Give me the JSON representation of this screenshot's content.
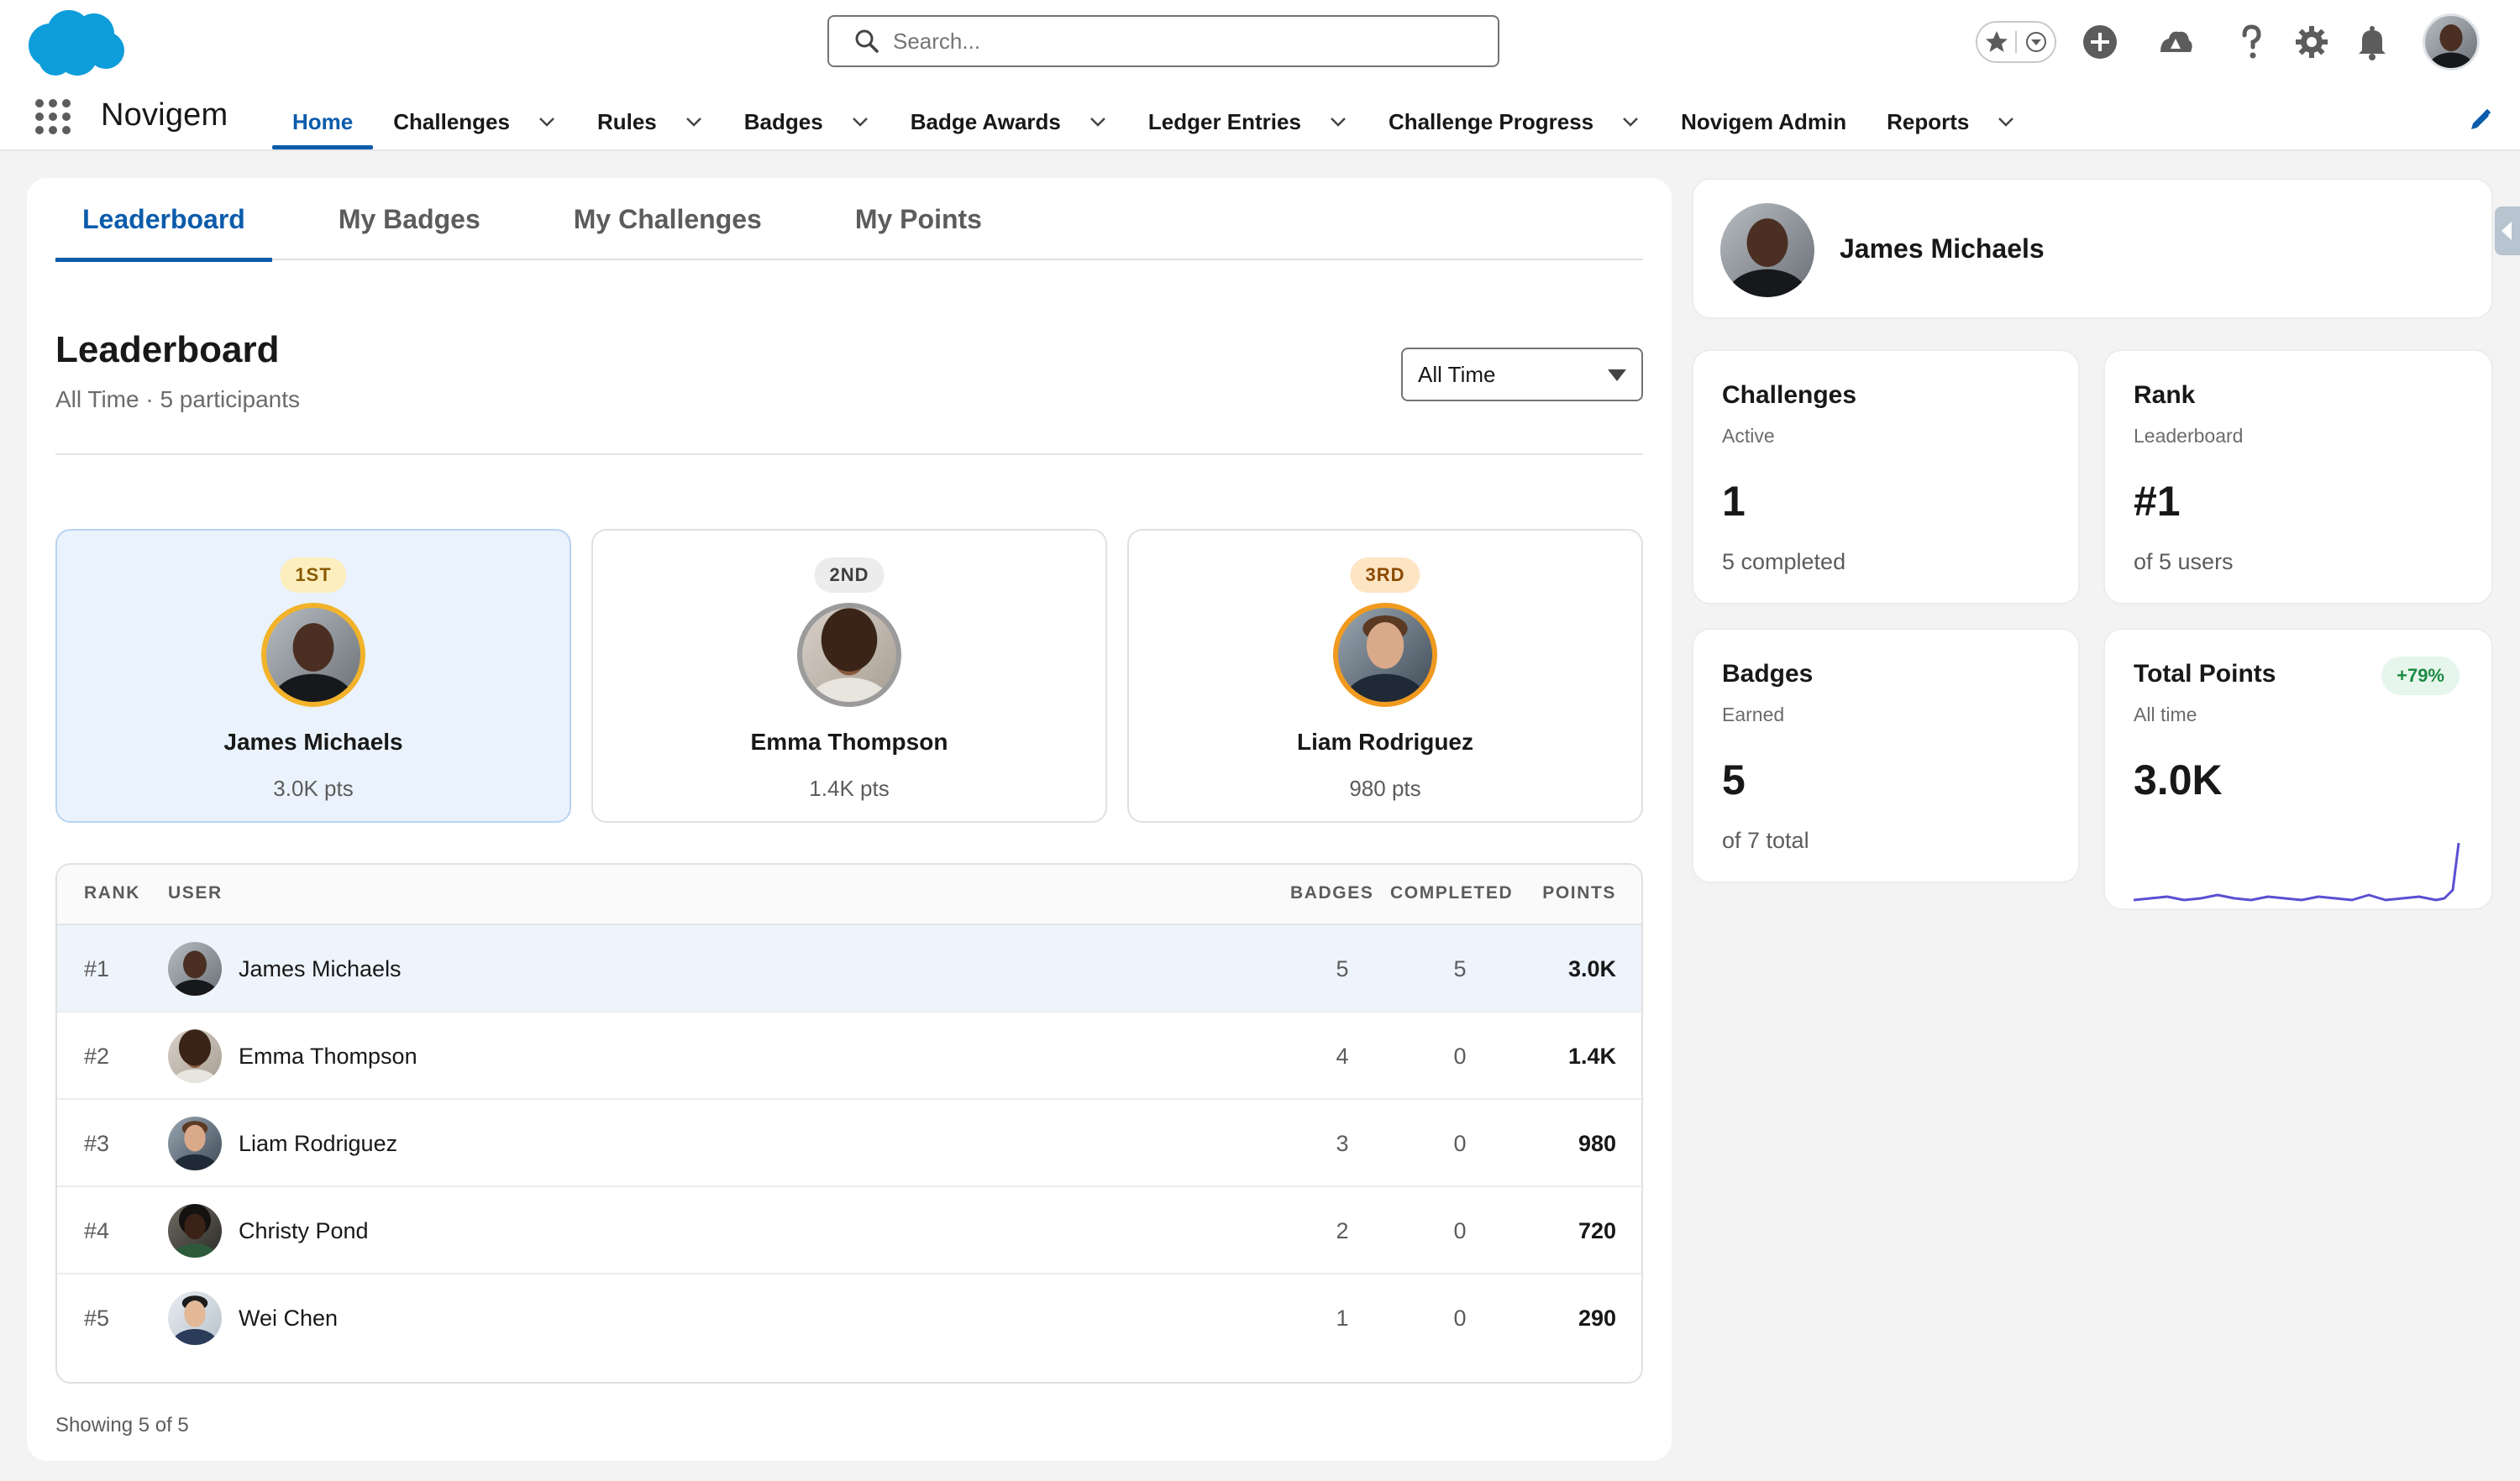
{
  "header": {
    "search_placeholder": "Search...",
    "icons": [
      "star-icon",
      "chevron-down-icon",
      "add-icon",
      "trailhead-icon",
      "help-icon",
      "setup-gear-icon",
      "bell-icon"
    ]
  },
  "app": {
    "name": "Novigem"
  },
  "nav": [
    {
      "label": "Home",
      "active": true,
      "menu": false
    },
    {
      "label": "Challenges",
      "menu": true
    },
    {
      "label": "Rules",
      "menu": true
    },
    {
      "label": "Badges",
      "menu": true
    },
    {
      "label": "Badge Awards",
      "menu": true
    },
    {
      "label": "Ledger Entries",
      "menu": true
    },
    {
      "label": "Challenge Progress",
      "menu": true
    },
    {
      "label": "Novigem Admin",
      "menu": false
    },
    {
      "label": "Reports",
      "menu": true
    }
  ],
  "tabs": [
    "Leaderboard",
    "My Badges",
    "My Challenges",
    "My Points"
  ],
  "leaderboard": {
    "title": "Leaderboard",
    "subtitle": "All Time · 5 participants",
    "period": "All Time",
    "podium": [
      {
        "rank_label": "1ST",
        "name": "James Michaels",
        "points": "3.0K pts"
      },
      {
        "rank_label": "2ND",
        "name": "Emma Thompson",
        "points": "1.4K pts"
      },
      {
        "rank_label": "3RD",
        "name": "Liam Rodriguez",
        "points": "980 pts"
      }
    ],
    "columns": {
      "rank": "RANK",
      "user": "USER",
      "badges": "BADGES",
      "completed": "COMPLETED",
      "points": "POINTS"
    },
    "rows": [
      {
        "rank": "#1",
        "name": "James Michaels",
        "badges": "5",
        "completed": "5",
        "points": "3.0K"
      },
      {
        "rank": "#2",
        "name": "Emma Thompson",
        "badges": "4",
        "completed": "0",
        "points": "1.4K"
      },
      {
        "rank": "#3",
        "name": "Liam Rodriguez",
        "badges": "3",
        "completed": "0",
        "points": "980"
      },
      {
        "rank": "#4",
        "name": "Christy Pond",
        "badges": "2",
        "completed": "0",
        "points": "720"
      },
      {
        "rank": "#5",
        "name": "Wei Chen",
        "badges": "1",
        "completed": "0",
        "points": "290"
      }
    ],
    "showing": "Showing 5 of 5"
  },
  "profile": {
    "name": "James Michaels"
  },
  "stats": {
    "challenges": {
      "title": "Challenges",
      "sub": "Active",
      "value": "1",
      "foot": "5 completed"
    },
    "rank": {
      "title": "Rank",
      "sub": "Leaderboard",
      "value": "#1",
      "foot": "of 5 users"
    },
    "badges": {
      "title": "Badges",
      "sub": "Earned",
      "value": "5",
      "foot": "of 7 total"
    },
    "points": {
      "title": "Total Points",
      "sub": "All time",
      "value": "3.0K",
      "trend": "+79%"
    }
  },
  "colors": {
    "brand": "#0b5cab",
    "salesforce_cloud": "#0d9dda",
    "sparkline": "#5a4fd3",
    "gold": "#f2b32a",
    "silver": "#9b9b9b",
    "bronze": "#f09a1f",
    "trend_positive": "#1e8a44"
  }
}
